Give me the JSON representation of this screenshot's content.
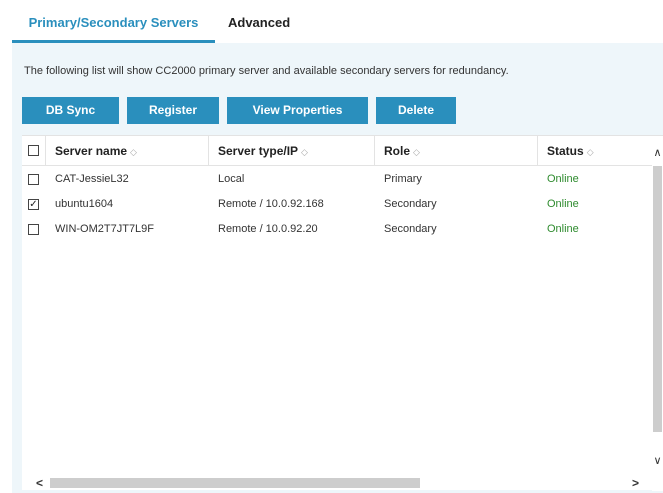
{
  "tabs": {
    "primary": "Primary/Secondary Servers",
    "advanced": "Advanced"
  },
  "description": "The following list will show CC2000 primary server and available secondary servers for redundancy.",
  "toolbar": {
    "db_sync": "DB Sync",
    "register": "Register",
    "view_properties": "View Properties",
    "delete": "Delete"
  },
  "table": {
    "headers": {
      "server_name": "Server name",
      "server_type": "Server type/IP",
      "role": "Role",
      "status": "Status"
    },
    "rows": [
      {
        "checked": false,
        "name": "CAT-JessieL32",
        "type": "Local",
        "role": "Primary",
        "status": "Online"
      },
      {
        "checked": true,
        "name": "ubuntu1604",
        "type": "Remote / 10.0.92.168",
        "role": "Secondary",
        "status": "Online"
      },
      {
        "checked": false,
        "name": "WIN-OM2T7JT7L9F",
        "type": "Remote / 10.0.92.20",
        "role": "Secondary",
        "status": "Online"
      }
    ]
  },
  "icons": {
    "sort": "sort-icon",
    "scroll_up": "chevron-up-icon",
    "scroll_down": "chevron-down-icon",
    "scroll_left": "chevron-left-icon",
    "scroll_right": "chevron-right-icon"
  },
  "colors": {
    "accent": "#2a8fbd",
    "panel_bg": "#eef6fa",
    "status_online": "#2e8b2e"
  }
}
